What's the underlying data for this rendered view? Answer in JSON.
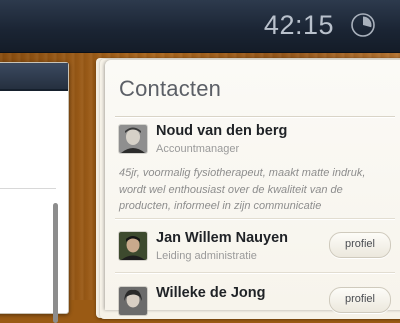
{
  "header": {
    "clock": "42:15",
    "timer_icon": "timer-icon"
  },
  "contacts_panel": {
    "title": "Contacten",
    "contacts": [
      {
        "name": "Noud van den berg",
        "role": "Accountmanager",
        "bio": "45jr, voormalig fysiotherapeut, maakt matte indruk, wordt wel enthousiast over de kwaliteit van de producten, informeel in zijn communicatie"
      },
      {
        "name": "Jan Willem Nauyen",
        "role": "Leiding administratie",
        "button_label": "profiel"
      },
      {
        "name": "Willeke de Jong",
        "button_label": "profiel"
      }
    ]
  }
}
